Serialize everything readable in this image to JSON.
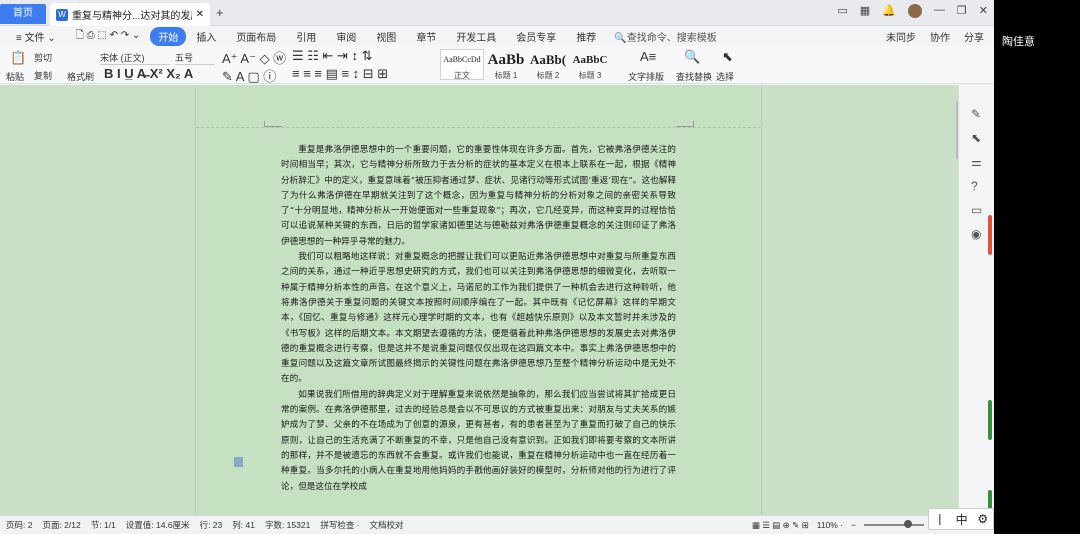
{
  "titlebar": {
    "home_tab": "首页",
    "doc_tab": "重复与精神分...达对其的发展",
    "doc_icon": "W",
    "close": "✕",
    "new_tab": "+"
  },
  "menu": {
    "items": [
      "≡ 文件 ⌄",
      "开始",
      "插入",
      "页面布局",
      "引用",
      "审阅",
      "视图",
      "章节",
      "开发工具",
      "会员专享",
      "推荐"
    ],
    "active_index": 1,
    "search": "🔍查找命令、搜索模板",
    "right": [
      "未同步",
      "协作",
      "分享"
    ]
  },
  "ribbon": {
    "paste": "粘贴",
    "cut": "剪切",
    "copy": "复制",
    "format_painter": "格式刷",
    "font_name": "宋体 (正文)",
    "font_size": "五号",
    "styles": [
      {
        "sample": "AaBbCcDd",
        "name": "正文"
      },
      {
        "sample": "AaBb",
        "name": "标题 1"
      },
      {
        "sample": "AaBb(",
        "name": "标题 2"
      },
      {
        "sample": "AaBbC",
        "name": "标题 3"
      }
    ],
    "text_layout": "文字排版",
    "find_replace": "查找替换",
    "select": "选择"
  },
  "document": {
    "paragraphs": [
      "重复是弗洛伊德思想中的一个重要问题，它的重要性体现在许多方面。首先，它被弗洛伊德关注的时间相当早；其次，它与精神分析所致力于去分析的症状的基本定义在根本上联系在一起，根据《精神分析辞汇》中的定义，重复意味着“被压抑者通过梦、症状、见诸行动等形式试图‘重返’现在”。这也解释了为什么弗洛伊德在早期就关注到了这个概念，因为重复与精神分析的分析对象之间的亲密关系导致了“十分明显地，精神分析从一开始便面对一些重复现象”；再次，它几经变异，而这种变异的过程恰恰可以追说某种关键的东西，日后的哲学家诸如德里达与德勒兹对弗洛伊德重复概念的关注则印证了弗洛伊德思想的一种异乎寻常的魅力。",
      "我们可以粗略地这样说：对重复概念的把握让我们可以更贴近弗洛伊德思想中对重复与所重复东西之间的关系，通过一种近乎思想史研究的方式，我们也可以关注到弗洛伊德思想的细微变化，去听取一种属于精神分析本性的声音。在这个意义上，马诺尼的工作为我们提供了一种机会去进行这种聆听，他将弗洛伊德关于重复问题的关键文本按照时间顺序编在了一起。其中既有《记忆屏幕》这样的早期文本，《回忆、重复与修通》这样元心理学时期的文本，也有《超越快乐原则》以及本文暂时并未涉及的《书写板》这样的后期文本。本文期望去遵循的方法，便是循着此种弗洛伊德思想的发展史去对弗洛伊德的重复概念进行考察，但是这并不是说重复问题仅仅出现在这四篇文本中。事实上弗洛伊德思想中的重复问题以及这篇文章所试图最终揭示的关键性问题在弗洛伊德思想乃至整个精神分析运动中是无处不在的。",
      "如果说我们所借用的辞典定义对于理解重复来说依然是抽象的，那么我们应当尝试将其扩拾成更日常的案例。在弗洛伊德那里，过去的经验总是会以不可思议的方式被重复出来：对朋友与丈夫关系的嫉妒成为了梦、父亲的不在场成为了创意的源泉，更有甚者，有的患者甚至为了重复而打破了自己的快乐原则，让自己的生活充满了不断重复的不幸，只是他自己没有意识到。正如我们即将要考察的文本所讲的那样，并不是被遗忘的东西就不会重复。或许我们也能说，重复在精神分析运动中也一直在经历着一种重复。当多尔托的小病人在重复地用他妈妈的手戳他画好装好的模型时，分析师对他的行为进行了评论，但是这位在学校成"
    ]
  },
  "status": {
    "page_num": "页码: 2",
    "pages": "页面: 2/12",
    "section": "节: 1/1",
    "setting": "设置值: 14.6厘米",
    "row": "行: 23",
    "col": "列: 41",
    "words": "字数: 15321",
    "spell": "拼写检查 ·",
    "proof": "文档校对",
    "zoom": "110% ·"
  },
  "ime": {
    "mode1": "丨",
    "mode2": "中",
    "settings": "⚙"
  },
  "user_name": "陶佳意",
  "colors": {
    "accent": "#3c7df0",
    "page_bg": "#c5e1c1",
    "doc_bg": "#c9dfc6"
  }
}
